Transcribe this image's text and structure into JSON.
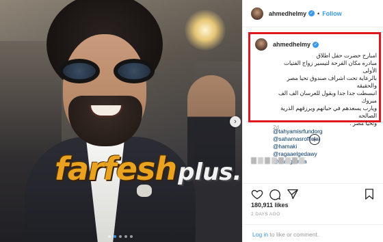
{
  "post": {
    "username": "ahmedhelmy",
    "follow_label": "Follow",
    "dot_separator": "•",
    "verified_glyph": "✓",
    "caption_lines": [
      "امبارح حضرت حفل اطلاق",
      "مبادره مكان الفرحة لتيسير زواج الفتيات الأولى",
      "بالرعاية تحت اشراف صندوق تحيا مصر والحقيقه",
      "انبسطت جدا جدا وبقول للعرسان الف الف مبروك",
      "ويارب يسعدهم في حياتهم ويرزقهم الذرية الصالحه",
      "وتحيا مصر ."
    ],
    "mentions": [
      "@tahyamisrfundorg",
      "@saharnasrofficial",
      "@hamaki",
      "@ragaaelgedawy",
      "@draligomaa"
    ],
    "time_ago": "2d",
    "load_more_glyph": "+",
    "likes": "180,911 likes",
    "date": "2 DAYS AGO",
    "login": {
      "link": "Log in",
      "rest": " to like or comment."
    }
  },
  "watermark": {
    "main": "farfesh",
    "sub": "plus.com"
  },
  "carousel": {
    "next_glyph": "›",
    "dot_count": 5,
    "active_index": 1
  },
  "colors": {
    "accent": "#3897f0",
    "highlight_border": "#e0161e",
    "mention": "#003569"
  },
  "icons": [
    "heart-icon",
    "comment-icon",
    "share-icon",
    "bookmark-icon",
    "verified-icon",
    "load-more-icon",
    "carousel-next-icon"
  ]
}
